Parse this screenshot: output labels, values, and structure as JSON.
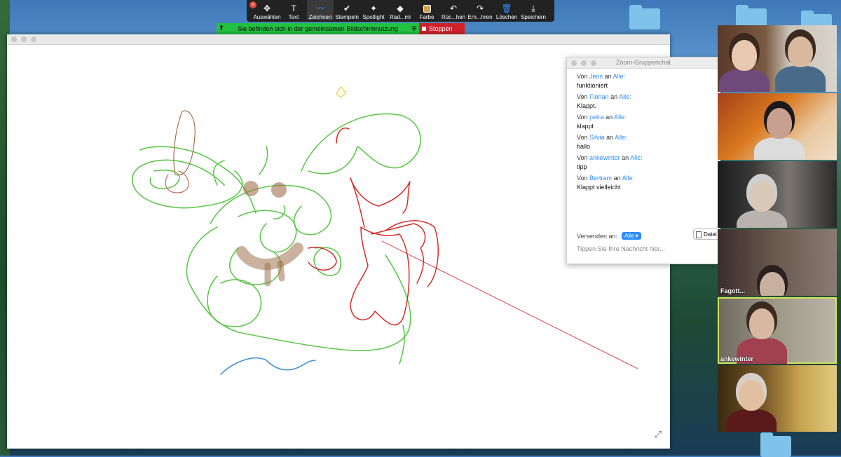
{
  "toolbar": {
    "tools": [
      {
        "icon": "move-icon",
        "glyph": "✥",
        "label": "Auswählen"
      },
      {
        "icon": "text-icon",
        "glyph": "T",
        "label": "Text"
      },
      {
        "icon": "draw-icon",
        "glyph": "〰",
        "label": "Zeichnen"
      },
      {
        "icon": "stamp-icon",
        "glyph": "✔",
        "label": "Stempeln"
      },
      {
        "icon": "spotlight-icon",
        "glyph": "✦",
        "label": "Spotlight"
      },
      {
        "icon": "eraser-icon",
        "glyph": "◆",
        "label": "Rad...mi"
      },
      {
        "icon": "color-icon",
        "glyph": "",
        "label": "Farbe"
      },
      {
        "icon": "undo-icon",
        "glyph": "↶",
        "label": "Rüc...hen"
      },
      {
        "icon": "redo-icon",
        "glyph": "↷",
        "label": "Ern...hren"
      },
      {
        "icon": "trash-icon",
        "glyph": "🗑",
        "label": "Löschen"
      },
      {
        "icon": "save-icon",
        "glyph": "⤓",
        "label": "Speichern"
      }
    ],
    "active_tool": "Zeichnen"
  },
  "share_bar": {
    "message": "Sie befinden sich in der gemeinsamen Bildschirmnutzung",
    "stop_label": "Stoppen"
  },
  "chat": {
    "title": "Zoom-Gruppenchat",
    "messages": [
      {
        "from_prefix": "Von",
        "sender": "Jens",
        "to_word": "an",
        "recipient": "Alle:",
        "text": "funktioniert"
      },
      {
        "from_prefix": "Von",
        "sender": "Florian",
        "to_word": "an",
        "recipient": "Alle:",
        "text": "Klappt."
      },
      {
        "from_prefix": "Von",
        "sender": "petra",
        "to_word": "an",
        "recipient": "Alle:",
        "text": "klappt"
      },
      {
        "from_prefix": "Von",
        "sender": "Silvia",
        "to_word": "an",
        "recipient": "Alle:",
        "text": "hallo"
      },
      {
        "from_prefix": "Von",
        "sender": "ankewinter",
        "to_word": "an",
        "recipient": "Alle:",
        "text": "tipp"
      },
      {
        "from_prefix": "Von",
        "sender": "Bertram",
        "to_word": "an",
        "recipient": "Alle:",
        "text": "Klappt vielleicht"
      }
    ],
    "send_to_label": "Versenden an:",
    "send_to_value": "Alle",
    "file_button": "Datei",
    "input_placeholder": "Tippen Sie Ihre Nachricht hier..."
  },
  "videos": {
    "tiles": [
      {
        "name": ""
      },
      {
        "name": ""
      },
      {
        "name": ""
      },
      {
        "name": "Fagott..."
      },
      {
        "name": "ankewinter",
        "active": true
      },
      {
        "name": ""
      }
    ]
  },
  "colors": {
    "draw_green": "#5ec84c",
    "draw_red": "#d62c2c",
    "draw_brown": "#a0724e",
    "draw_blue": "#3b8fd8",
    "draw_yellow": "#f0c419",
    "accent": "#2d8cff",
    "stop_red": "#d0212b",
    "share_green": "#22c241"
  }
}
